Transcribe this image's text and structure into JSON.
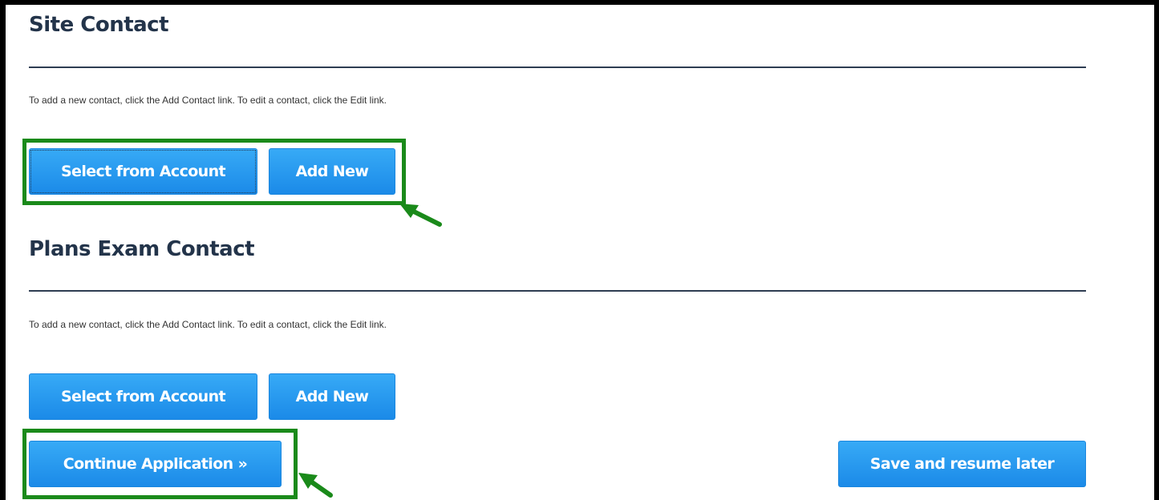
{
  "site_contact": {
    "heading": "Site Contact",
    "note": "To add a new contact, click the Add Contact link. To edit a contact, click the Edit link.",
    "select_label": "Select from Account",
    "add_label": "Add New"
  },
  "plans_exam_contact": {
    "heading": "Plans Exam Contact",
    "note": "To add a new contact, click the Add Contact link. To edit a contact, click the Edit link.",
    "select_label": "Select from Account",
    "add_label": "Add New"
  },
  "footer": {
    "continue_label": "Continue Application »",
    "save_label": "Save and resume later"
  },
  "annotations": {
    "highlight_color": "#1a8a1a",
    "arrow_icon": "arrow-pointer-icon"
  },
  "colors": {
    "button_blue": "#2a9bef",
    "heading": "#23344a"
  }
}
